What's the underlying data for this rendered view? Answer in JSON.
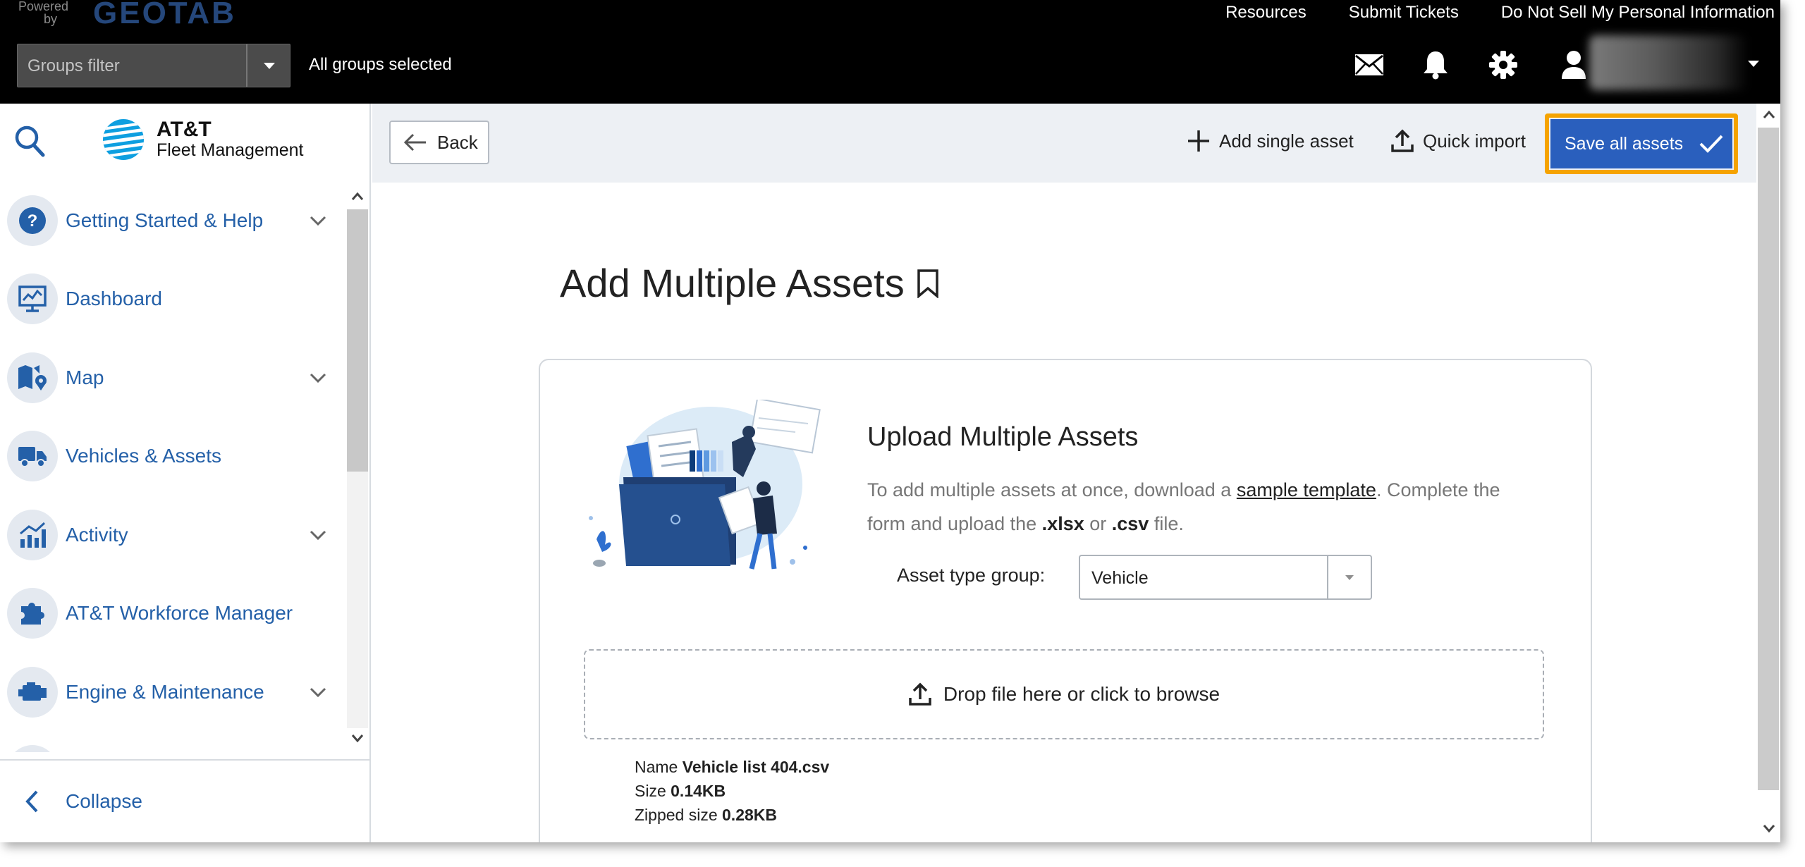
{
  "topbar": {
    "powered": "Powered",
    "by": "by",
    "brand": "GEOTAB",
    "links": [
      "Resources",
      "Submit Tickets",
      "Do Not Sell My Personal Information"
    ],
    "groups_filter_placeholder": "Groups filter",
    "groups_status": "All groups selected",
    "icons": [
      "mail-icon",
      "bell-icon",
      "gear-icon",
      "user-icon"
    ]
  },
  "sidebar": {
    "logo_line1": "AT&T",
    "logo_line2": "Fleet Management",
    "items": [
      {
        "label": "Getting Started & Help",
        "icon": "help-icon",
        "expandable": true
      },
      {
        "label": "Dashboard",
        "icon": "dashboard-icon",
        "expandable": false
      },
      {
        "label": "Map",
        "icon": "map-icon",
        "expandable": true
      },
      {
        "label": "Vehicles & Assets",
        "icon": "truck-icon",
        "expandable": false
      },
      {
        "label": "Activity",
        "icon": "activity-icon",
        "expandable": true
      },
      {
        "label": "AT&T Workforce Manager",
        "icon": "puzzle-icon",
        "expandable": false
      },
      {
        "label": "Engine & Maintenance",
        "icon": "engine-icon",
        "expandable": true
      }
    ],
    "collapse_label": "Collapse"
  },
  "toolbar": {
    "back_label": "Back",
    "add_single_label": "Add single asset",
    "quick_import_label": "Quick import",
    "save_all_label": "Save all assets"
  },
  "page": {
    "title": "Add Multiple Assets"
  },
  "upload": {
    "title": "Upload Multiple Assets",
    "desc_part1": "To add multiple assets at once, download a ",
    "desc_link": "sample template",
    "desc_part2": ". Complete the form and upload the ",
    "desc_ext1": ".xlsx",
    "desc_or": " or ",
    "desc_ext2": ".csv",
    "desc_part3": " file.",
    "asset_type_label": "Asset type group:",
    "asset_type_value": "Vehicle",
    "dropzone_label": "Drop file here or click to browse",
    "file": {
      "name_label": "Name",
      "name_value": "Vehicle list 404.csv",
      "size_label": "Size",
      "size_value": "0.14KB",
      "zipped_label": "Zipped size",
      "zipped_value": "0.28KB"
    }
  },
  "colors": {
    "topbar_bg": "#000000",
    "brand_blue": "#25477b",
    "nav_text": "#2460a8",
    "primary_button": "#2a5fbd",
    "highlight_border": "#f5a300",
    "toolbar_bg": "#edf0f4"
  }
}
